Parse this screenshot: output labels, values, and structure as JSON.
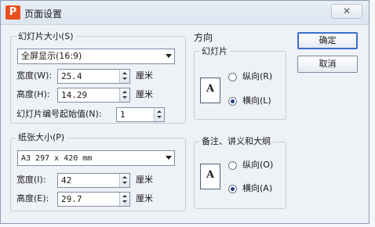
{
  "window": {
    "title": "页面设置",
    "app_icon_letter": "P",
    "close_glyph": "✕"
  },
  "slide_size": {
    "legend": "幻灯片大小(S)",
    "preset": "全屏显示(16:9)",
    "width_label": "宽度(W):",
    "width_value": "25.4",
    "height_label": "高度(H):",
    "height_value": "14.29",
    "unit": "厘米",
    "start_number_label": "幻灯片编号起始值(N):",
    "start_number_value": "1"
  },
  "paper_size": {
    "legend": "纸张大小(P)",
    "preset": "A3 297 x 420 mm",
    "width_label": "宽度(I):",
    "width_value": "42",
    "height_label": "高度(E):",
    "height_value": "29.7",
    "unit": "厘米"
  },
  "orientation": {
    "legend": "方向",
    "slides": {
      "label": "幻灯片",
      "page_letter": "A",
      "portrait_label": "纵向(R)",
      "landscape_label": "横向(L)",
      "selected": "landscape"
    },
    "notes": {
      "label": "备注、讲义和大纲",
      "page_letter": "A",
      "portrait_label": "纵向(O)",
      "landscape_label": "横向(A)",
      "selected": "landscape"
    }
  },
  "buttons": {
    "ok": "确定",
    "cancel": "取消"
  }
}
